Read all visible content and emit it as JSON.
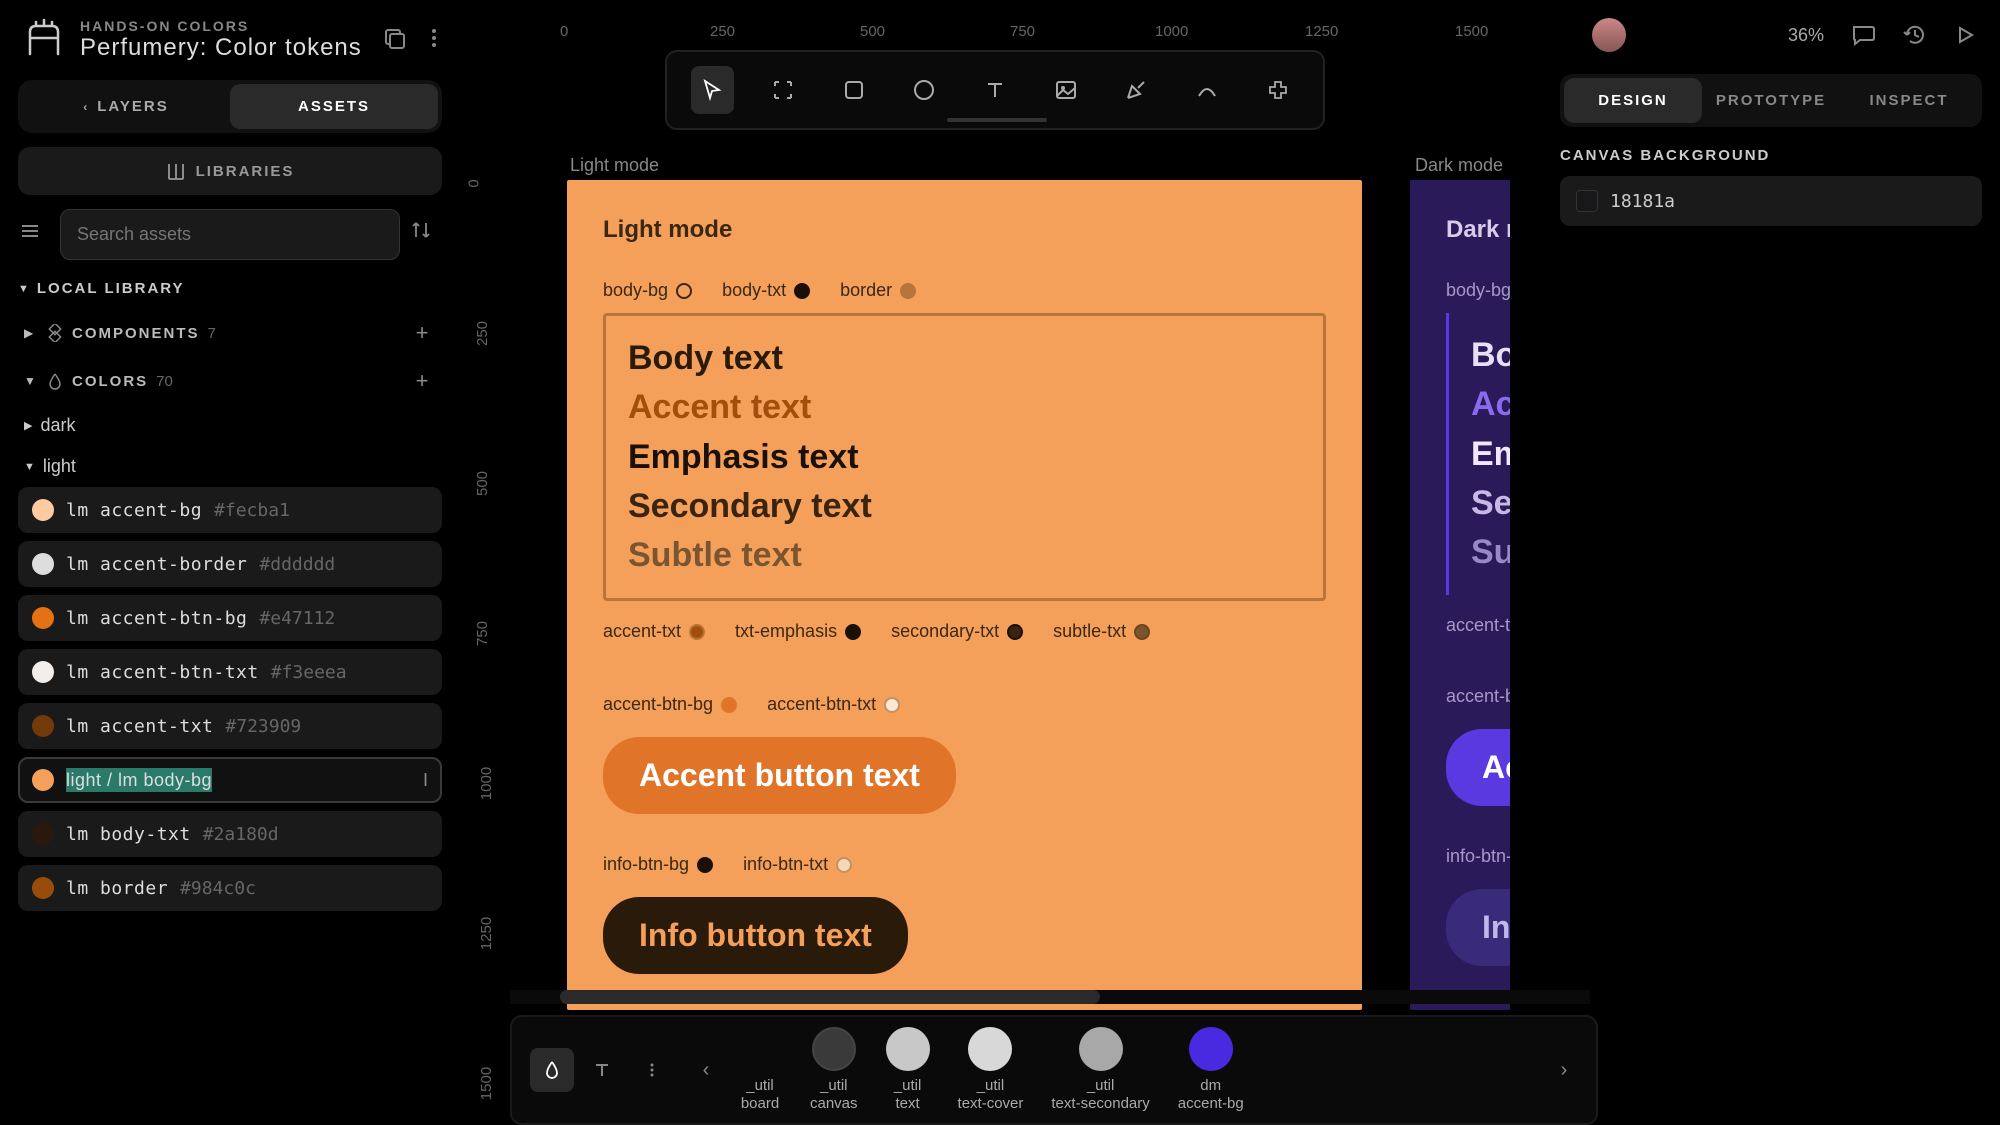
{
  "header": {
    "eyebrow": "HANDS-ON COLORS",
    "title": "Perfumery: Color tokens"
  },
  "ruler_top": [
    "0",
    "250",
    "500",
    "750",
    "1000",
    "1250",
    "1500"
  ],
  "ruler_left": [
    "0",
    "250",
    "500",
    "750",
    "1000",
    "1250",
    "1500"
  ],
  "left_tabs": {
    "layers": "LAYERS",
    "assets": "ASSETS"
  },
  "libraries": "LIBRARIES",
  "search_placeholder": "Search assets",
  "local_library": "LOCAL LIBRARY",
  "collections": {
    "components": {
      "name": "COMPONENTS",
      "count": "7"
    },
    "colors": {
      "name": "COLORS",
      "count": "70"
    }
  },
  "folders": {
    "dark": "dark",
    "light": "light"
  },
  "color_items": [
    {
      "name": "lm accent-bg",
      "hex": "#fecba1",
      "swatch": "#fecba1"
    },
    {
      "name": "lm accent-border",
      "hex": "#dddddd",
      "swatch": "#dddddd"
    },
    {
      "name": "lm accent-btn-bg",
      "hex": "#e47112",
      "swatch": "#e47112"
    },
    {
      "name": "lm accent-btn-txt",
      "hex": "#f3eeea",
      "swatch": "#f3eeea"
    },
    {
      "name": "lm accent-txt",
      "hex": "#723909",
      "swatch": "#723909"
    },
    {
      "name": "lm body-txt",
      "hex": "#2a180d",
      "swatch": "#2a180d"
    },
    {
      "name": "lm border",
      "hex": "#984c0c",
      "swatch": "#984c0c"
    }
  ],
  "editing_item": {
    "value": "light / lm body-bg",
    "swatch": "#f5a05a"
  },
  "canvas": {
    "light_label": "Light mode",
    "dark_label": "Dark mode",
    "light": {
      "title": "Light mode",
      "tokens_row1": [
        "body-bg",
        "body-txt",
        "border"
      ],
      "text_block": [
        "Body text",
        "Accent text",
        "Emphasis text",
        "Secondary text",
        "Subtle text"
      ],
      "text_colors": [
        "#2a1a0a",
        "#8a4512",
        "#1a1008",
        "#4a3018",
        "#6a4a2a"
      ],
      "tokens_row2": [
        "accent-txt",
        "txt-emphasis",
        "secondary-txt",
        "subtle-txt"
      ],
      "tokens_row3": [
        "accent-btn-bg",
        "accent-btn-txt"
      ],
      "accent_btn": "Accent button text",
      "tokens_row4": [
        "info-btn-bg",
        "info-btn-txt"
      ],
      "info_btn": "Info button text"
    },
    "dark": {
      "title": "Dark mo",
      "tokens_row1": [
        "body-bg"
      ],
      "text_block": [
        "Bo",
        "Ac",
        "Em",
        "Se",
        "Su"
      ],
      "tokens_row2": [
        "accent-t"
      ],
      "tokens_row3": [
        "accent-b"
      ],
      "accent_btn": "Ac",
      "tokens_row4": [
        "info-btn-"
      ],
      "info_btn": "In"
    }
  },
  "swatch_bar": [
    {
      "label": "_util board",
      "color": "#0a0a0a"
    },
    {
      "label": "_util canvas",
      "color": "#3a3a3a",
      "border": true
    },
    {
      "label": "_util text",
      "color": "#c8c8c8"
    },
    {
      "label": "_util text-cover",
      "color": "#d8d8d8"
    },
    {
      "label": "_util text-secondary",
      "color": "#a8a8a8"
    },
    {
      "label": "dm accent-bg",
      "color": "#4a2ae0"
    }
  ],
  "top_right": {
    "zoom": "36%"
  },
  "right_panel": {
    "tabs": [
      "DESIGN",
      "PROTOTYPE",
      "INSPECT"
    ],
    "bg_section": "CANVAS BACKGROUND",
    "bg_value": "18181a"
  }
}
